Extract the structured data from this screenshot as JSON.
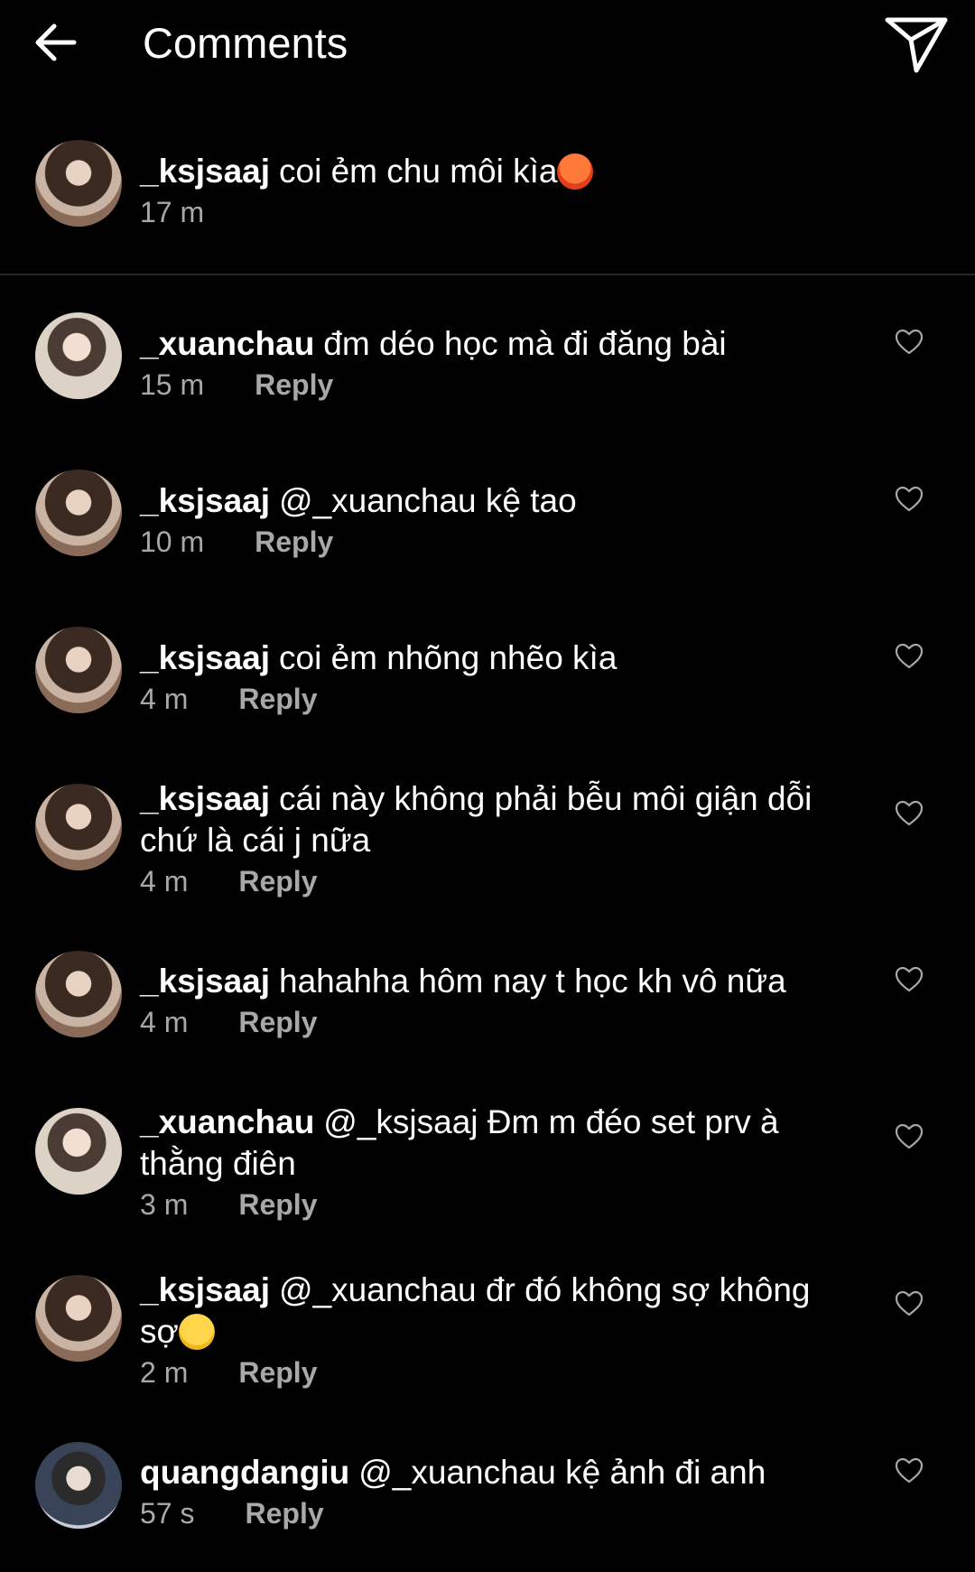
{
  "header": {
    "title": "Comments",
    "back_icon": "arrow-left-icon",
    "send_icon": "send-icon"
  },
  "caption": {
    "username": "_ksjsaaj",
    "text": "coi ẻm chu môi kìa",
    "emoji": "angry-face-emoji",
    "time": "17 m"
  },
  "comments": [
    {
      "username": "_xuanchau",
      "text": "đm déo học mà đi đăng bài",
      "time": "15 m",
      "reply": "Reply"
    },
    {
      "username": "_ksjsaaj",
      "text": "@_xuanchau kệ tao",
      "time": "10 m",
      "reply": "Reply"
    },
    {
      "username": "_ksjsaaj",
      "text": "coi ẻm nhõng nhẽo kìa",
      "time": "4 m",
      "reply": "Reply"
    },
    {
      "username": "_ksjsaaj",
      "text": "cái này không phải bễu môi giận dỗi chứ là cái j nữa",
      "time": "4 m",
      "reply": "Reply"
    },
    {
      "username": "_ksjsaaj",
      "text": "hahahha hôm nay t học kh vô nữa",
      "time": "4 m",
      "reply": "Reply"
    },
    {
      "username": "_xuanchau",
      "text": "@_ksjsaaj Đm m đéo set prv à thằng điên",
      "time": "3 m",
      "reply": "Reply"
    },
    {
      "username": "_ksjsaaj",
      "text": "@_xuanchau đr đó không sợ không sợ",
      "emoji": "squinting-tongue-emoji",
      "time": "2 m",
      "reply": "Reply"
    },
    {
      "username": "quangdangiu",
      "text": "@_xuanchau kệ ảnh đi anh",
      "time": "57 s",
      "reply": "Reply"
    }
  ],
  "colors": {
    "background": "#000000",
    "text": "#ffffff",
    "secondary": "#a8a8a8",
    "divider": "#2a2a2a"
  }
}
